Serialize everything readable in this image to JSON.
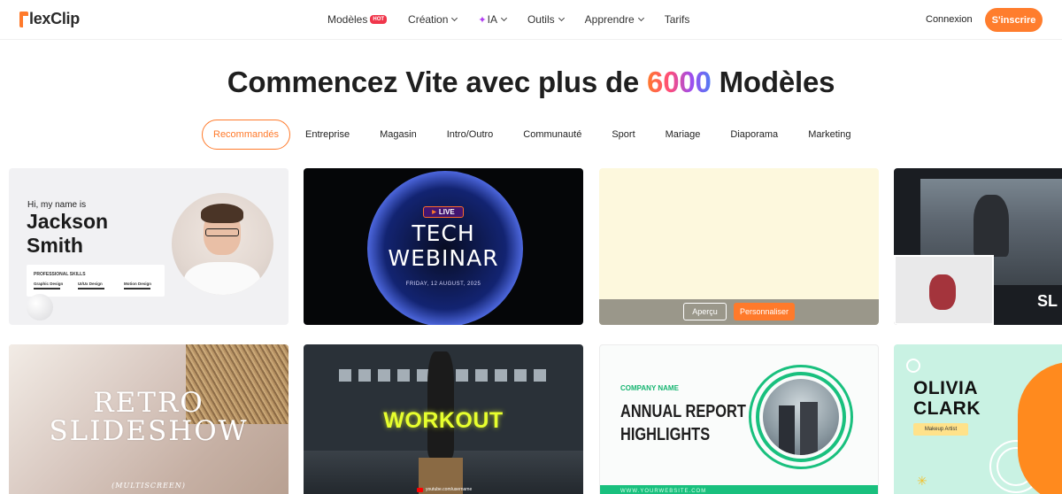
{
  "brand": {
    "logo_text": "lexClip",
    "accent": "#ff7a2b"
  },
  "nav": {
    "items": [
      {
        "label": "Modèles",
        "badge": "HOT",
        "has_chevron": false
      },
      {
        "label": "Création",
        "has_chevron": true
      },
      {
        "label": "IA",
        "icon": "sparkle-icon",
        "has_chevron": true
      },
      {
        "label": "Outils",
        "has_chevron": true
      },
      {
        "label": "Apprendre",
        "has_chevron": true
      },
      {
        "label": "Tarifs",
        "has_chevron": false
      }
    ],
    "login": "Connexion",
    "signup": "S'inscrire"
  },
  "hero": {
    "title_before": "Commencez Vite avec plus de ",
    "title_highlight": "6000",
    "title_after": " Modèles"
  },
  "tabs": [
    "Recommandés",
    "Entreprise",
    "Magasin",
    "Intro/Outro",
    "Communauté",
    "Sport",
    "Mariage",
    "Diaporama",
    "Marketing"
  ],
  "active_tab": "Recommandés",
  "cards": {
    "resume": {
      "greeting": "Hi, my name is",
      "name_line1": "Jackson",
      "name_line2": "Smith",
      "skills_title": "PROFESSIONAL SKILLS",
      "skills": [
        "Graphic Design",
        "UI/Ux Design",
        "Motion Design"
      ]
    },
    "webinar": {
      "badge": "LIVE",
      "title_line1": "TECH",
      "title_line2": "WEBINAR",
      "date": "FRIDAY, 12 AUGUST, 2025"
    },
    "hover": {
      "preview_label": "Aperçu",
      "customize_label": "Personnaliser"
    },
    "photo_slide": {
      "text": "SL"
    },
    "retro": {
      "title_line1": "RETRO",
      "title_line2": "SLIDESHOW",
      "subtitle": "(MULTISCREEN)"
    },
    "workout": {
      "title": "WORKOUT",
      "channel": "youtube.com/username"
    },
    "annual": {
      "company": "COMPANY NAME",
      "title_line1": "ANNUAL REPORT",
      "title_line2": "HIGHLIGHTS",
      "url": "WWW.YOURWEBSITE.COM"
    },
    "olivia": {
      "title_line1": "OLIVIA",
      "title_line2": "CLARK",
      "tag": "Makeup Artist"
    }
  }
}
